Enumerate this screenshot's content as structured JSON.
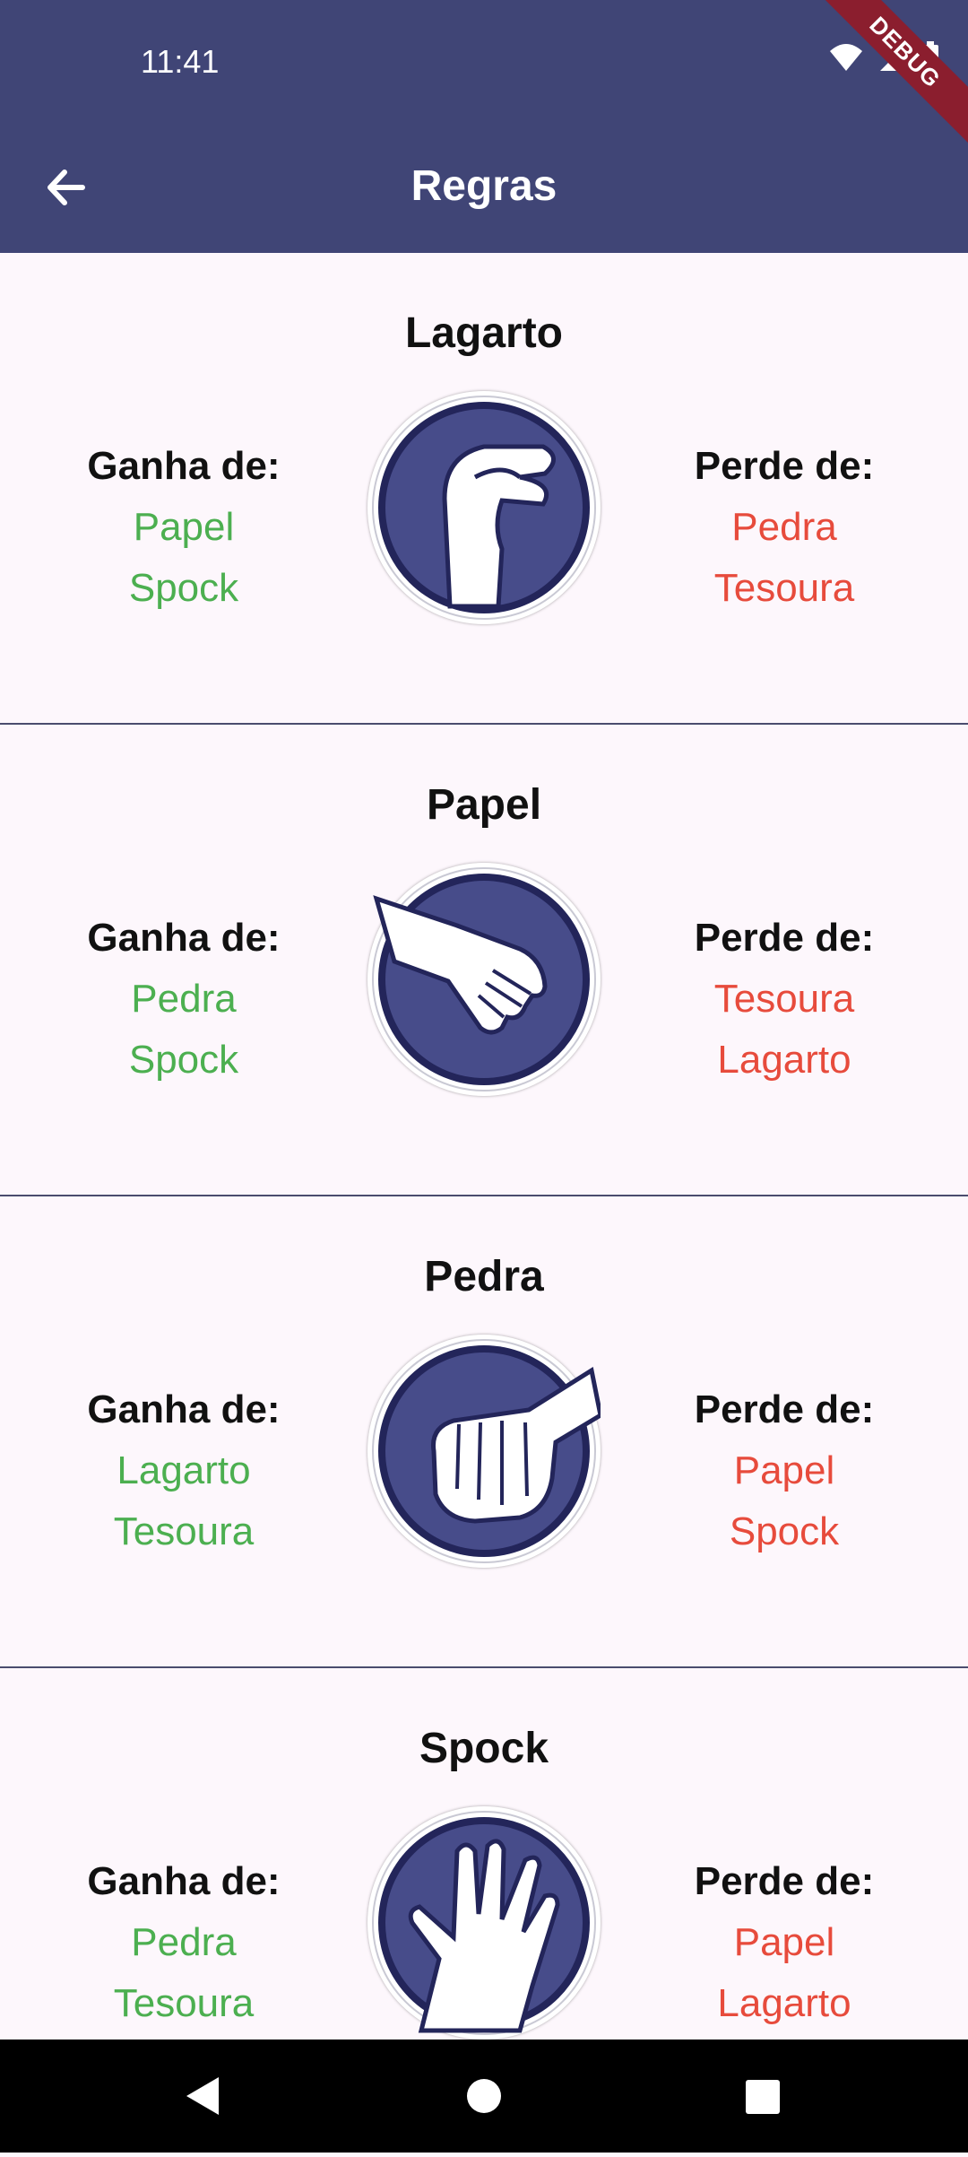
{
  "status_bar": {
    "time": "11:41",
    "debug_label": "DEBUG"
  },
  "app_bar": {
    "title": "Regras",
    "back_icon": "arrow-back-icon"
  },
  "colors": {
    "primary": "#404576",
    "win": "#4caf50",
    "lose": "#e74b3c"
  },
  "labels": {
    "wins": "Ganha de:",
    "loses": "Perde de:"
  },
  "rules": [
    {
      "name": "Lagarto",
      "icon": "lizard-hand-icon",
      "wins": [
        "Papel",
        "Spock"
      ],
      "loses": [
        "Pedra",
        "Tesoura"
      ]
    },
    {
      "name": "Papel",
      "icon": "paper-hand-icon",
      "wins": [
        "Pedra",
        "Spock"
      ],
      "loses": [
        "Tesoura",
        "Lagarto"
      ]
    },
    {
      "name": "Pedra",
      "icon": "rock-fist-icon",
      "wins": [
        "Lagarto",
        "Tesoura"
      ],
      "loses": [
        "Papel",
        "Spock"
      ]
    },
    {
      "name": "Spock",
      "icon": "spock-hand-icon",
      "wins": [
        "Pedra",
        "Tesoura"
      ],
      "loses": [
        "Papel",
        "Lagarto"
      ]
    }
  ],
  "nav_bar": {
    "back": "nav-back-icon",
    "home": "nav-home-icon",
    "recents": "nav-recents-icon"
  }
}
